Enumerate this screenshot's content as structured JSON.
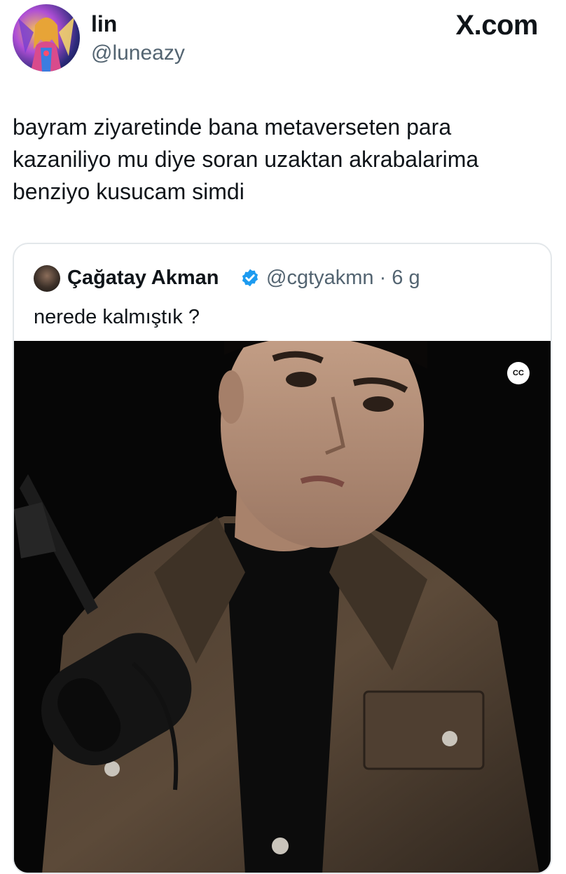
{
  "author": {
    "display_name": "lin",
    "handle": "@luneazy"
  },
  "source_logo": "X.com",
  "tweet": {
    "text": "bayram ziyaretinde bana metaverseten para\nkazaniliyo mu diye soran uzaktan akrabalarima\nbenziyo kusucam simdi"
  },
  "quoted_tweet": {
    "author_name": "Çağatay Akman",
    "meta": "@cgtyakmn · 6 g",
    "text": "nerede kalmıştık ?",
    "media": {
      "caption_badge": "CC"
    }
  },
  "colors": {
    "text_primary": "#0f1419",
    "text_secondary": "#536471",
    "verified_blue": "#1d9bf0",
    "border": "#e3e7ea"
  },
  "icons": {
    "verified": "verified-badge-icon",
    "captions": "closed-captions-icon"
  }
}
